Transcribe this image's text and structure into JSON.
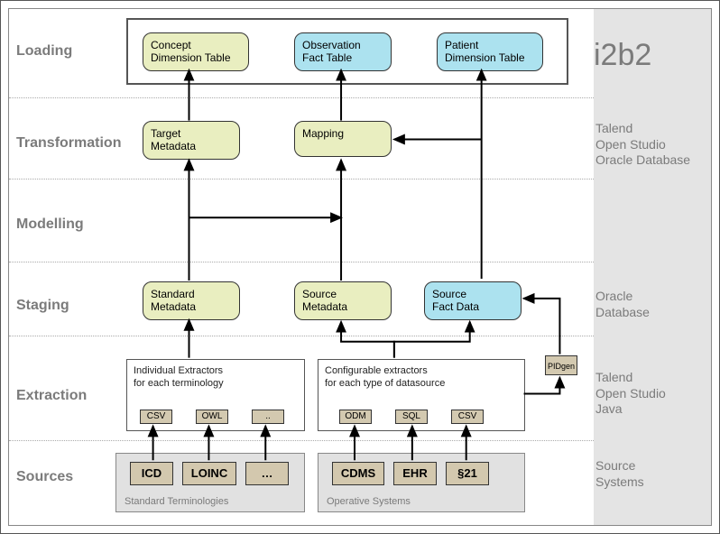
{
  "rows": {
    "loading": "Loading",
    "transformation": "Transformation",
    "modelling": "Modelling",
    "staging": "Staging",
    "extraction": "Extraction",
    "sources": "Sources"
  },
  "side": {
    "i2b2": "i2b2",
    "transform": "Talend\nOpen Studio\nOracle Database",
    "staging": "Oracle\nDatabase",
    "extraction": "Talend\nOpen Studio\nJava",
    "sources": "Source\nSystems"
  },
  "loading": {
    "concept": "Concept\nDimension Table",
    "observation": "Observation\nFact Table",
    "patient": "Patient\nDimension Table"
  },
  "transform": {
    "target": "Target\nMetadata",
    "mapping": "Mapping"
  },
  "staging": {
    "standard": "Standard\nMetadata",
    "source": "Source\nMetadata",
    "fact": "Source\nFact Data"
  },
  "extraction": {
    "left_caption": "Individual Extractors\nfor each terminology",
    "right_caption": "Configurable extractors\nfor each type of datasource",
    "csv": "CSV",
    "owl": "OWL",
    "dots": "..",
    "odm": "ODM",
    "sql": "SQL"
  },
  "pidgen": "PIDgen",
  "sources": {
    "std_caption": "Standard Terminologies",
    "op_caption": "Operative Systems",
    "icd": "ICD",
    "loinc": "LOINC",
    "dots": "…",
    "cdms": "CDMS",
    "ehr": "EHR",
    "p21": "§21"
  }
}
